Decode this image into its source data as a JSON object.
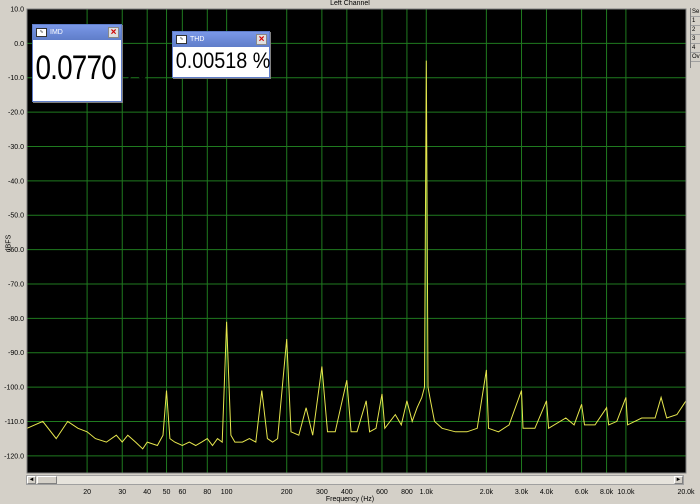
{
  "window": {
    "title": "Left Channel"
  },
  "colors": {
    "plot_bg": "#000000",
    "grid": "#1f7a1f",
    "trace": "#e6e64d",
    "window_bg": "#d4d0c8",
    "meter_title": "#5f7dc9"
  },
  "meters": {
    "imd": {
      "title": "IMD",
      "icon": "meter-icon",
      "value": "0.0770 %"
    },
    "thd": {
      "title": "THD",
      "icon": "meter-icon",
      "value": "0.00518 %"
    }
  },
  "sidebar": {
    "items": [
      "Se",
      "1",
      "2",
      "3",
      "4",
      "Ov"
    ]
  },
  "scrollbar": {
    "left_arrow": "◄",
    "right_arrow": "►"
  },
  "chart_data": {
    "type": "line",
    "title": "Left Channel",
    "xlabel": "Frequency (Hz)",
    "ylabel": "dBFS",
    "x_scale": "log",
    "xlim": [
      10,
      20000
    ],
    "ylim": [
      -125,
      10
    ],
    "x_ticks": [
      {
        "v": 20,
        "label": "20"
      },
      {
        "v": 30,
        "label": "30"
      },
      {
        "v": 40,
        "label": "40"
      },
      {
        "v": 50,
        "label": "50"
      },
      {
        "v": 60,
        "label": "60"
      },
      {
        "v": 80,
        "label": "80"
      },
      {
        "v": 100,
        "label": "100"
      },
      {
        "v": 200,
        "label": "200"
      },
      {
        "v": 300,
        "label": "300"
      },
      {
        "v": 400,
        "label": "400"
      },
      {
        "v": 600,
        "label": "600"
      },
      {
        "v": 800,
        "label": "800"
      },
      {
        "v": 1000,
        "label": "1.0k"
      },
      {
        "v": 2000,
        "label": "2.0k"
      },
      {
        "v": 3000,
        "label": "3.0k"
      },
      {
        "v": 4000,
        "label": "4.0k"
      },
      {
        "v": 6000,
        "label": "6.0k"
      },
      {
        "v": 8000,
        "label": "8.0k"
      },
      {
        "v": 10000,
        "label": "10.0k"
      },
      {
        "v": 20000,
        "label": "20.0k"
      }
    ],
    "y_ticks": [
      {
        "v": 10,
        "label": "10.0"
      },
      {
        "v": 0,
        "label": "0.0"
      },
      {
        "v": -10,
        "label": "-10.0"
      },
      {
        "v": -20,
        "label": "-20.0"
      },
      {
        "v": -30,
        "label": "-30.0"
      },
      {
        "v": -40,
        "label": "-40.0"
      },
      {
        "v": -50,
        "label": "-50.0"
      },
      {
        "v": -60,
        "label": "-60.0"
      },
      {
        "v": -70,
        "label": "-70.0"
      },
      {
        "v": -80,
        "label": "-80.0"
      },
      {
        "v": -90,
        "label": "-90.0"
      },
      {
        "v": -100,
        "label": "-100.0"
      },
      {
        "v": -110,
        "label": "-110.0"
      },
      {
        "v": -120,
        "label": "-120.0"
      }
    ],
    "series": [
      {
        "points": [
          [
            10,
            -112
          ],
          [
            12,
            -110
          ],
          [
            14,
            -115
          ],
          [
            16,
            -110
          ],
          [
            18,
            -112
          ],
          [
            20,
            -113
          ],
          [
            22,
            -115
          ],
          [
            25,
            -116
          ],
          [
            28,
            -114
          ],
          [
            30,
            -116
          ],
          [
            32,
            -114
          ],
          [
            35,
            -116
          ],
          [
            38,
            -118
          ],
          [
            40,
            -116
          ],
          [
            45,
            -117
          ],
          [
            48,
            -114
          ],
          [
            50,
            -101
          ],
          [
            52,
            -115
          ],
          [
            55,
            -116
          ],
          [
            60,
            -117
          ],
          [
            65,
            -116
          ],
          [
            70,
            -117
          ],
          [
            75,
            -116
          ],
          [
            80,
            -115
          ],
          [
            85,
            -117
          ],
          [
            90,
            -115
          ],
          [
            95,
            -116
          ],
          [
            100,
            -81
          ],
          [
            105,
            -114
          ],
          [
            110,
            -116
          ],
          [
            120,
            -116
          ],
          [
            130,
            -115
          ],
          [
            140,
            -116
          ],
          [
            150,
            -101
          ],
          [
            160,
            -115
          ],
          [
            170,
            -116
          ],
          [
            180,
            -115
          ],
          [
            200,
            -86
          ],
          [
            210,
            -113
          ],
          [
            230,
            -114
          ],
          [
            250,
            -106
          ],
          [
            270,
            -114
          ],
          [
            300,
            -94
          ],
          [
            320,
            -113
          ],
          [
            350,
            -113
          ],
          [
            400,
            -98
          ],
          [
            420,
            -113
          ],
          [
            450,
            -113
          ],
          [
            500,
            -104
          ],
          [
            520,
            -113
          ],
          [
            560,
            -112
          ],
          [
            600,
            -102
          ],
          [
            620,
            -112
          ],
          [
            700,
            -108
          ],
          [
            750,
            -111
          ],
          [
            800,
            -104
          ],
          [
            850,
            -110
          ],
          [
            900,
            -106
          ],
          [
            950,
            -103
          ],
          [
            980,
            -100
          ],
          [
            1000,
            -5
          ],
          [
            1020,
            -100
          ],
          [
            1050,
            -104
          ],
          [
            1100,
            -110
          ],
          [
            1200,
            -112
          ],
          [
            1400,
            -113
          ],
          [
            1600,
            -113
          ],
          [
            1800,
            -112
          ],
          [
            2000,
            -95
          ],
          [
            2050,
            -112
          ],
          [
            2300,
            -113
          ],
          [
            2600,
            -111
          ],
          [
            3000,
            -101
          ],
          [
            3050,
            -112
          ],
          [
            3500,
            -112
          ],
          [
            4000,
            -104
          ],
          [
            4100,
            -112
          ],
          [
            5000,
            -109
          ],
          [
            5500,
            -111
          ],
          [
            6000,
            -105
          ],
          [
            6200,
            -111
          ],
          [
            7000,
            -111
          ],
          [
            8000,
            -106
          ],
          [
            8200,
            -111
          ],
          [
            9000,
            -110
          ],
          [
            10000,
            -103
          ],
          [
            10200,
            -111
          ],
          [
            12000,
            -109
          ],
          [
            14000,
            -109
          ],
          [
            15000,
            -103
          ],
          [
            16000,
            -109
          ],
          [
            18000,
            -108
          ],
          [
            20000,
            -104
          ]
        ]
      }
    ]
  },
  "axis_text": {
    "x_title": "Frequency (Hz)",
    "y_title": "dBFS"
  }
}
